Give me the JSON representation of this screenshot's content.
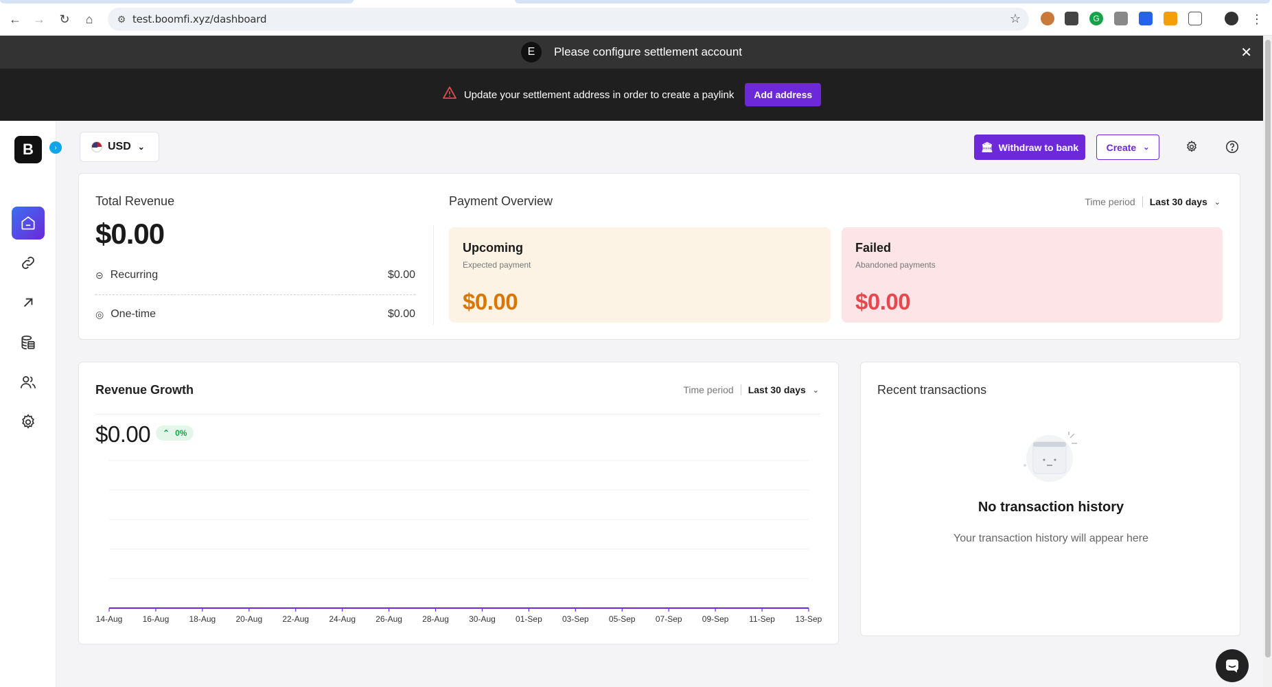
{
  "browser": {
    "url": "test.boomfi.xyz/dashboard"
  },
  "notice": {
    "badge": "E",
    "text": "Please configure settlement account",
    "close": "✕"
  },
  "warning": {
    "text": "Update your settlement address in order to create a paylink",
    "button": "Add address"
  },
  "sidebar": {
    "logo": "B",
    "items": [
      {
        "name": "home",
        "active": true
      },
      {
        "name": "links"
      },
      {
        "name": "payouts"
      },
      {
        "name": "transactions"
      },
      {
        "name": "customers"
      },
      {
        "name": "settings"
      }
    ]
  },
  "topbar": {
    "currency": "USD",
    "withdraw": "Withdraw to bank",
    "create": "Create"
  },
  "total_revenue": {
    "title": "Total Revenue",
    "value": "$0.00",
    "recurring_label": "Recurring",
    "recurring_value": "$0.00",
    "onetime_label": "One-time",
    "onetime_value": "$0.00"
  },
  "payment_overview": {
    "title": "Payment Overview",
    "period_label": "Time period",
    "period_value": "Last 30 days",
    "upcoming": {
      "title": "Upcoming",
      "subtitle": "Expected payment",
      "value": "$0.00"
    },
    "failed": {
      "title": "Failed",
      "subtitle": "Abandoned payments",
      "value": "$0.00"
    }
  },
  "revenue_growth": {
    "title": "Revenue Growth",
    "period_label": "Time period",
    "period_value": "Last 30 days",
    "value": "$0.00",
    "change": "0%"
  },
  "chart_data": {
    "type": "line",
    "title": "Revenue Growth",
    "xlabel": "",
    "ylabel": "",
    "categories": [
      "14-Aug",
      "16-Aug",
      "18-Aug",
      "20-Aug",
      "22-Aug",
      "24-Aug",
      "26-Aug",
      "28-Aug",
      "30-Aug",
      "01-Sep",
      "03-Sep",
      "05-Sep",
      "07-Sep",
      "09-Sep",
      "11-Sep",
      "13-Sep"
    ],
    "values": [
      0,
      0,
      0,
      0,
      0,
      0,
      0,
      0,
      0,
      0,
      0,
      0,
      0,
      0,
      0,
      0
    ],
    "grid": true,
    "line_color": "#6d28d9"
  },
  "recent": {
    "title": "Recent transactions",
    "empty_title": "No transaction history",
    "empty_subtitle": "Your transaction history will appear here"
  },
  "colors": {
    "accent": "#6d28d9",
    "upcoming": "#d97706",
    "failed": "#e5484d",
    "positive": "#16a34a"
  }
}
